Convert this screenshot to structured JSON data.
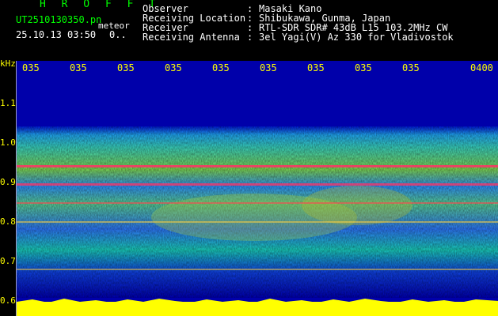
{
  "header": {
    "title": "H R O F F T",
    "file_name": "UT2510130350.pn",
    "suffix": "meteor",
    "timestamp": "25.10.13 03:50",
    "count": "0..",
    "info": [
      {
        "label": "Observer",
        "value": "Masaki Kano"
      },
      {
        "label": "Receiving Location",
        "value": "Shibukawa, Gunma, Japan"
      },
      {
        "label": "Receiver",
        "value": "RTL-SDR SDR# 43dB L15 103.2MHz CW"
      },
      {
        "label": "Receiving Antenna",
        "value": "3el Yagi(V) Az 330 for Vladivostok"
      }
    ],
    "separator": ":"
  },
  "axes": {
    "y_unit": "kHz",
    "x_ticks": [
      "035",
      "035",
      "035",
      "035",
      "035",
      "035",
      "035",
      "035",
      "035",
      "0400"
    ],
    "y_ticks": [
      "1.1",
      "1.0",
      "0.9",
      "0.8",
      "0.7",
      "0.6"
    ]
  },
  "colors": {
    "background": "#0000aa",
    "label_green": "#00ff00",
    "label_yellow": "#ffff00",
    "hot": "#ff3366"
  }
}
